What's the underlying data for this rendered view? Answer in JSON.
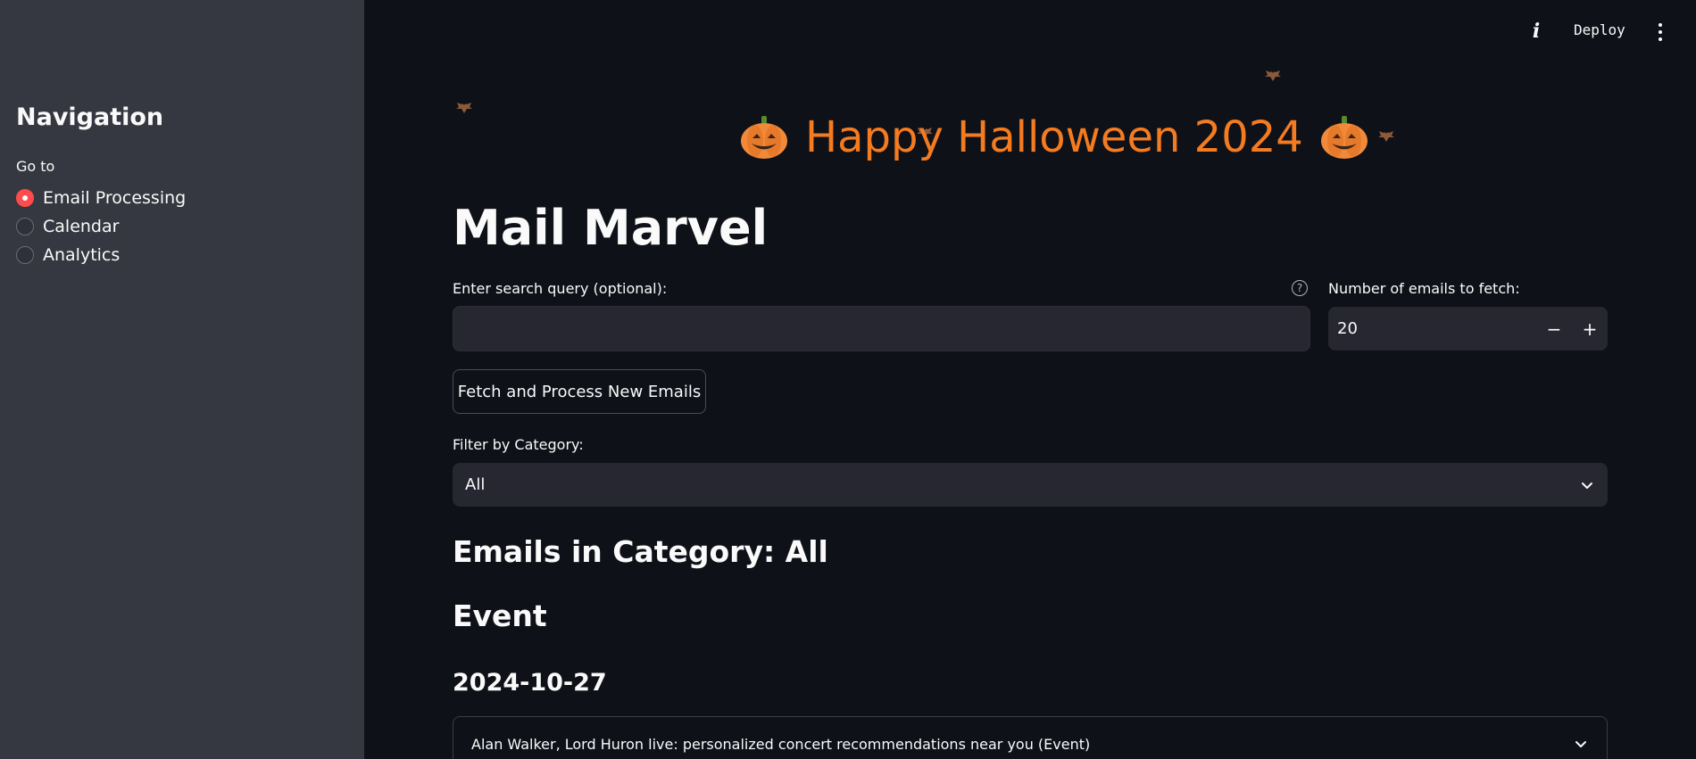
{
  "sidebar": {
    "title": "Navigation",
    "goto_label": "Go to",
    "options": [
      {
        "label": "Email Processing",
        "selected": true
      },
      {
        "label": "Calendar",
        "selected": false
      },
      {
        "label": "Analytics",
        "selected": false
      }
    ]
  },
  "topbar": {
    "info_icon": "info-icon",
    "deploy_label": "Deploy",
    "menu_icon": "kebab-menu-icon"
  },
  "banner": {
    "text": "Happy Halloween 2024",
    "color": "#f47b20",
    "icons": [
      "pumpkin-icon",
      "bat-icon"
    ]
  },
  "main": {
    "title": "Mail Marvel",
    "search": {
      "label": "Enter search query (optional):",
      "value": "",
      "placeholder": ""
    },
    "count": {
      "label": "Number of emails to fetch:",
      "value": "20",
      "minus": "−",
      "plus": "+"
    },
    "fetch_button": "Fetch and Process New Emails",
    "filter": {
      "label": "Filter by Category:",
      "value": "All"
    },
    "emails_heading": "Emails in Category: All",
    "category_heading": "Event",
    "date_heading": "2024-10-27",
    "email_item": "Alan Walker, Lord Huron live: personalized concert recommendations near you (Event)"
  },
  "colors": {
    "background": "#0e1117",
    "sidebar": "#363841",
    "accent": "#ff4b4b",
    "input": "#262730"
  }
}
